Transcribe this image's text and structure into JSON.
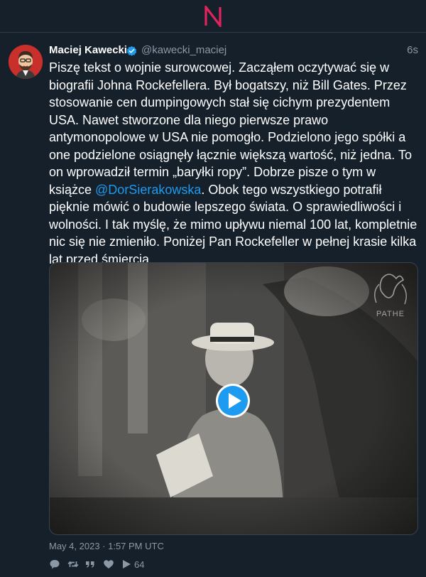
{
  "tweet": {
    "author_name": "Maciej Kawecki",
    "handle": "@kawecki_maciej",
    "time_ago": "6s",
    "text_before_mention": "Piszę tekst o wojnie surowcowej. Zacząłem oczytywać się w biografii Johna Rockefellera. Był bogatszy, niż Bill Gates. Przez stosowanie cen dumpingowych stał się cichym prezydentem USA. Nawet stworzone dla niego pierwsze prawo antymonopolowe w USA nie pomogło. Podzielono jego spółki a one podzielone osiągnęły łącznie większą wartość, niż jedna. To on wprowadził termin „baryłki ropy”. Dobrze pisze o tym w książce ",
    "mention": "@DorSierakowska",
    "text_after_mention": ". Obok tego wszystkiego potrafił pięknie mówić o budowie lepszego świata. O sprawiedliwości i wolności. I tak myślę, że mimo upływu niemal 100 lat, kompletnie nic się nie zmieniło. Poniżej Pan Rockefeller w pełnej krasie kilka lat przed śmiercią.",
    "timestamp": "May 4, 2023 · 1:57 PM UTC",
    "view_count": "64"
  },
  "media": {
    "watermark": "PATHE",
    "play_icon": "play-icon"
  },
  "colors": {
    "background": "#15202b",
    "accent": "#1d9bf0",
    "muted": "#8b98a5",
    "logo_red": "#e0245e"
  }
}
